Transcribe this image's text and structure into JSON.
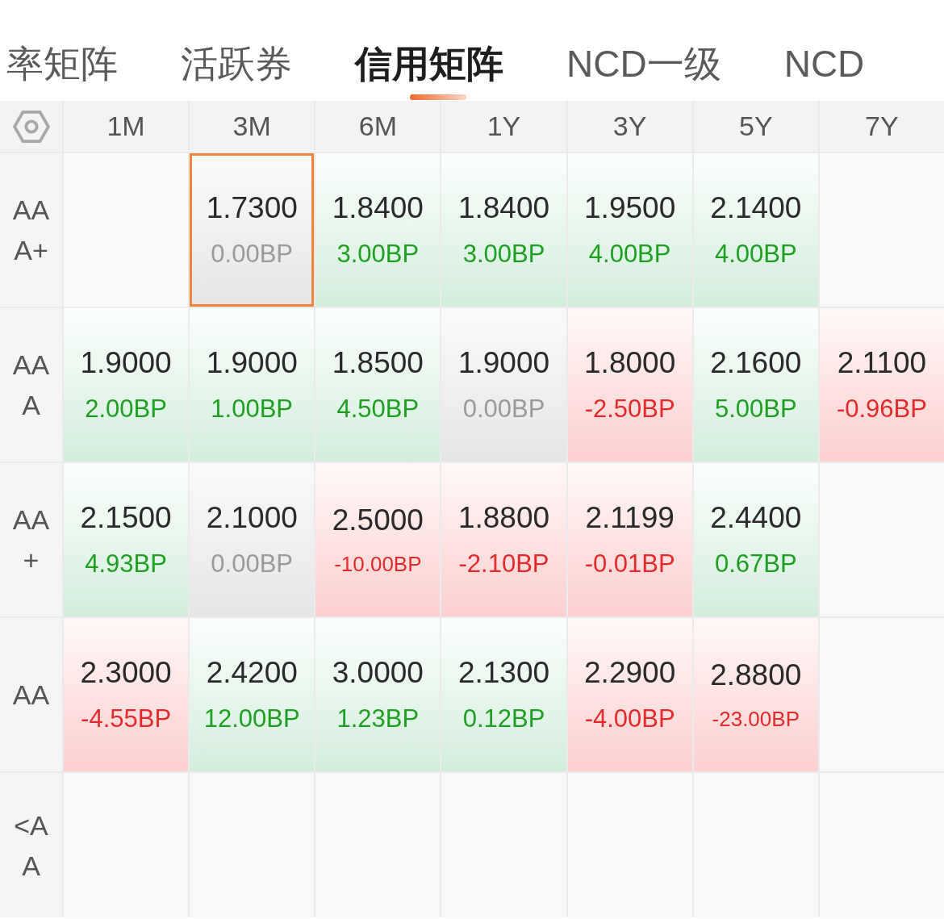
{
  "tabs": [
    {
      "label": "率矩阵",
      "selected": false
    },
    {
      "label": "活跃券",
      "selected": false
    },
    {
      "label": "信用矩阵",
      "selected": true
    },
    {
      "label": "NCD一级",
      "selected": false
    },
    {
      "label": "NCD",
      "selected": false
    }
  ],
  "matrix": {
    "columns": [
      "1M",
      "3M",
      "6M",
      "1Y",
      "3Y",
      "5Y",
      "7Y"
    ],
    "rows": [
      {
        "label": "AAA+",
        "cells": [
          {
            "kind": "empty"
          },
          {
            "kind": "flat",
            "rate": "1.7300",
            "change": "0.00BP",
            "selected": true
          },
          {
            "kind": "up",
            "rate": "1.8400",
            "change": "3.00BP",
            "selected": false
          },
          {
            "kind": "up",
            "rate": "1.8400",
            "change": "3.00BP",
            "selected": false
          },
          {
            "kind": "up",
            "rate": "1.9500",
            "change": "4.00BP",
            "selected": false
          },
          {
            "kind": "up",
            "rate": "2.1400",
            "change": "4.00BP",
            "selected": false
          },
          {
            "kind": "empty"
          }
        ]
      },
      {
        "label": "AAA",
        "cells": [
          {
            "kind": "up",
            "rate": "1.9000",
            "change": "2.00BP",
            "selected": false
          },
          {
            "kind": "up",
            "rate": "1.9000",
            "change": "1.00BP",
            "selected": false
          },
          {
            "kind": "up",
            "rate": "1.8500",
            "change": "4.50BP",
            "selected": false
          },
          {
            "kind": "flat",
            "rate": "1.9000",
            "change": "0.00BP",
            "selected": false
          },
          {
            "kind": "down",
            "rate": "1.8000",
            "change": "-2.50BP",
            "selected": false
          },
          {
            "kind": "up",
            "rate": "2.1600",
            "change": "5.00BP",
            "selected": false
          },
          {
            "kind": "down",
            "rate": "2.1100",
            "change": "-0.96BP",
            "selected": false
          }
        ]
      },
      {
        "label": "AA+",
        "cells": [
          {
            "kind": "up",
            "rate": "2.1500",
            "change": "4.93BP",
            "selected": false
          },
          {
            "kind": "flat",
            "rate": "2.1000",
            "change": "0.00BP",
            "selected": false
          },
          {
            "kind": "down",
            "rate": "2.5000",
            "change": "-10.00BP",
            "selected": false
          },
          {
            "kind": "down",
            "rate": "1.8800",
            "change": "-2.10BP",
            "selected": false
          },
          {
            "kind": "down",
            "rate": "2.1199",
            "change": "-0.01BP",
            "selected": false
          },
          {
            "kind": "up",
            "rate": "2.4400",
            "change": "0.67BP",
            "selected": false
          },
          {
            "kind": "empty"
          }
        ]
      },
      {
        "label": "AA",
        "cells": [
          {
            "kind": "down",
            "rate": "2.3000",
            "change": "-4.55BP",
            "selected": false
          },
          {
            "kind": "up",
            "rate": "2.4200",
            "change": "12.00BP",
            "selected": false
          },
          {
            "kind": "up",
            "rate": "3.0000",
            "change": "1.23BP",
            "selected": false
          },
          {
            "kind": "up",
            "rate": "2.1300",
            "change": "0.12BP",
            "selected": false
          },
          {
            "kind": "down",
            "rate": "2.2900",
            "change": "-4.00BP",
            "selected": false
          },
          {
            "kind": "down",
            "rate": "2.8800",
            "change": "-23.00BP",
            "selected": false
          },
          {
            "kind": "empty"
          }
        ]
      },
      {
        "label": "<AA",
        "cells": [
          {
            "kind": "empty"
          },
          {
            "kind": "empty"
          },
          {
            "kind": "empty"
          },
          {
            "kind": "empty"
          },
          {
            "kind": "empty"
          },
          {
            "kind": "empty"
          },
          {
            "kind": "empty"
          }
        ]
      }
    ]
  }
}
